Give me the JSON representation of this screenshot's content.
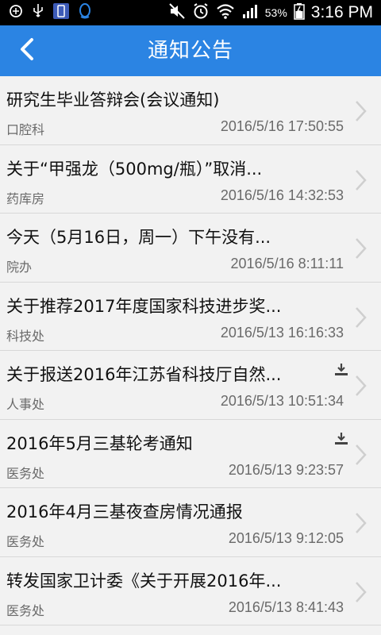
{
  "status_bar": {
    "battery_percent": "53%",
    "time": "3:16 PM"
  },
  "header": {
    "title": "通知公告"
  },
  "colors": {
    "header_bg": "#2b84e3",
    "list_bg": "#f2f2f2",
    "secondary_text": "#6a6a6a"
  },
  "notices": [
    {
      "title": "研究生毕业答辩会(会议通知)",
      "source": "口腔科",
      "time": "2016/5/16 17:50:55",
      "attachment": false
    },
    {
      "title": "关于“甲强龙（500mg/瓶）”取消...",
      "source": "药库房",
      "time": "2016/5/16 14:32:53",
      "attachment": false
    },
    {
      "title": "今天（5月16日，周一）下午没有...",
      "source": "院办",
      "time": "2016/5/16 8:11:11",
      "attachment": false
    },
    {
      "title": "关于推荐2017年度国家科技进步奖...",
      "source": "科技处",
      "time": "2016/5/13 16:16:33",
      "attachment": false
    },
    {
      "title": "关于报送2016年江苏省科技厅自然...",
      "source": "人事处",
      "time": "2016/5/13 10:51:34",
      "attachment": true
    },
    {
      "title": "2016年5月三基轮考通知",
      "source": "医务处",
      "time": "2016/5/13 9:23:57",
      "attachment": true
    },
    {
      "title": "2016年4月三基夜查房情况通报",
      "source": "医务处",
      "time": "2016/5/13 9:12:05",
      "attachment": false
    },
    {
      "title": "转发国家卫计委《关于开展2016年...",
      "source": "医务处",
      "time": "2016/5/13 8:41:43",
      "attachment": false
    }
  ]
}
